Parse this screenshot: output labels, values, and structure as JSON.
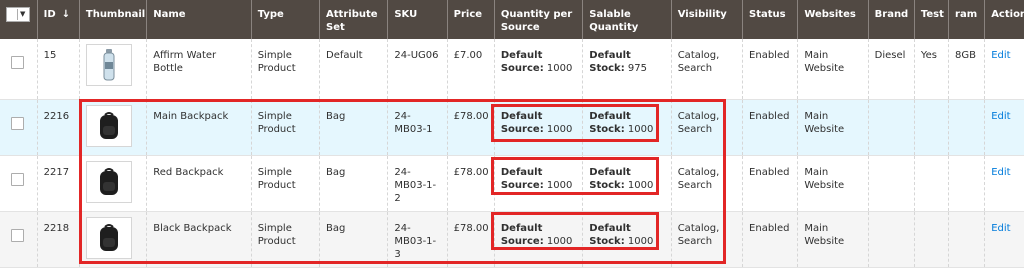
{
  "header": {
    "id": "ID",
    "sort_arrow": "↓",
    "thumbnail": "Thumbnail",
    "name": "Name",
    "type": "Type",
    "attribute_set": "Attribute Set",
    "sku": "SKU",
    "price": "Price",
    "qty_per_source": "Quantity per Source",
    "salable_qty": "Salable Quantity",
    "visibility": "Visibility",
    "status": "Status",
    "websites": "Websites",
    "brand": "Brand",
    "test": "Test",
    "ram": "ram",
    "action": "Action"
  },
  "rows": [
    {
      "id": "15",
      "thumb": "water-bottle",
      "name": "Affirm Water Bottle",
      "type": "Simple Product",
      "attr_set": "Default",
      "sku": "24-UG06",
      "price": "£7.00",
      "source_label": "Default Source:",
      "source_qty": "1000",
      "stock_label": "Default Stock:",
      "stock_qty": "975",
      "visibility": "Catalog, Search",
      "status": "Enabled",
      "websites": "Main Website",
      "brand": "Diesel",
      "test": "Yes",
      "ram": "8GB",
      "action": "Edit"
    },
    {
      "id": "2216",
      "thumb": "backpack",
      "name": "Main Backpack",
      "type": "Simple Product",
      "attr_set": "Bag",
      "sku": "24-MB03-1",
      "price": "£78.00",
      "source_label": "Default Source:",
      "source_qty": "1000",
      "stock_label": "Default Stock:",
      "stock_qty": "1000",
      "visibility": "Catalog, Search",
      "status": "Enabled",
      "websites": "Main Website",
      "brand": "",
      "test": "",
      "ram": "",
      "action": "Edit"
    },
    {
      "id": "2217",
      "thumb": "backpack",
      "name": "Red Backpack",
      "type": "Simple Product",
      "attr_set": "Bag",
      "sku": "24-MB03-1-2",
      "price": "£78.00",
      "source_label": "Default Source:",
      "source_qty": "1000",
      "stock_label": "Default Stock:",
      "stock_qty": "1000",
      "visibility": "Catalog, Search",
      "status": "Enabled",
      "websites": "Main Website",
      "brand": "",
      "test": "",
      "ram": "",
      "action": "Edit"
    },
    {
      "id": "2218",
      "thumb": "backpack",
      "name": "Black Backpack",
      "type": "Simple Product",
      "attr_set": "Bag",
      "sku": "24-MB03-1-3",
      "price": "£78.00",
      "source_label": "Default Source:",
      "source_qty": "1000",
      "stock_label": "Default Stock:",
      "stock_qty": "1000",
      "visibility": "Catalog, Search",
      "status": "Enabled",
      "websites": "Main Website",
      "brand": "",
      "test": "",
      "ram": "",
      "action": "Edit"
    }
  ],
  "colors": {
    "header_bg": "#514943",
    "link": "#007bdb",
    "highlight": "#e22626",
    "selected_row": "#e5f7fe"
  }
}
